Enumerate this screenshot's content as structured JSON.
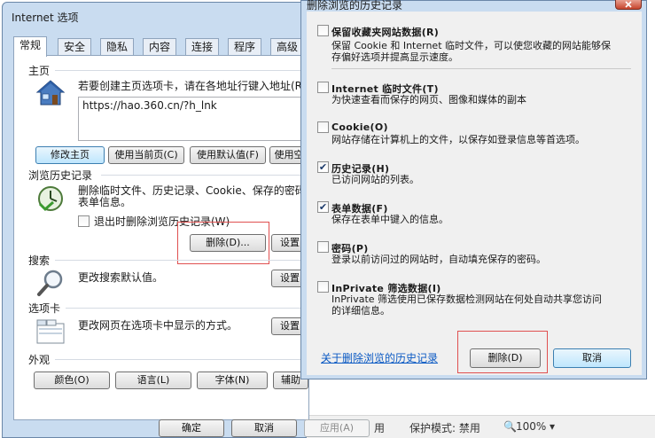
{
  "browser_bg": {
    "status_use": "用",
    "status_security": "保护模式: 禁用",
    "zoom": "100%"
  },
  "options": {
    "title": "Internet 选项",
    "tabs": [
      "常规",
      "安全",
      "隐私",
      "内容",
      "连接",
      "程序",
      "高级"
    ],
    "homepage": {
      "section": "主页",
      "instruction": "若要创建主页选项卡，请在各地址行键入地址(R",
      "url": "https://hao.360.cn/?h_lnk",
      "btn_current": "使用当前页(C)",
      "btn_default": "使用默认值(F)",
      "btn_blank": "使用空",
      "btn_edit": "修改主页"
    },
    "history": {
      "section": "浏览历史记录",
      "desc_line1": "删除临时文件、历史记录、Cookie、保存的密码",
      "desc_line2": "表单信息。",
      "exit_checkbox": "退出时删除浏览历史记录(W)",
      "btn_delete": "删除(D)...",
      "btn_settings": "设置"
    },
    "search": {
      "section": "搜索",
      "desc": "更改搜索默认值。",
      "btn_settings": "设置"
    },
    "tabs_section": {
      "section": "选项卡",
      "desc": "更改网页在选项卡中显示的方式。",
      "btn_settings": "设置"
    },
    "appearance": {
      "section": "外观",
      "btn_colors": "颜色(O)",
      "btn_languages": "语言(L)",
      "btn_fonts": "字体(N)",
      "btn_accessibility": "辅助"
    },
    "footer": {
      "ok": "确定",
      "cancel": "取消",
      "apply": "应用(A)"
    }
  },
  "delete_dialog": {
    "title": "删除浏览的历史记录",
    "items": [
      {
        "label": "保留收藏夹网站数据(R)",
        "desc1": "保留 Cookie 和 Internet 临时文件，可以使您收藏的网站能够保",
        "desc2": "存偏好选项并提高显示速度。",
        "checked": false
      },
      {
        "label": "Internet 临时文件(T)",
        "desc1": "为快速查看而保存的网页、图像和媒体的副本",
        "desc2": "",
        "checked": false
      },
      {
        "label": "Cookie(O)",
        "desc1": "网站存储在计算机上的文件，以保存如登录信息等首选项。",
        "desc2": "",
        "checked": false
      },
      {
        "label": "历史记录(H)",
        "desc1": "已访问网站的列表。",
        "desc2": "",
        "checked": true
      },
      {
        "label": "表单数据(F)",
        "desc1": "保存在表单中键入的信息。",
        "desc2": "",
        "checked": true
      },
      {
        "label": "密码(P)",
        "desc1": "登录以前访问过的网站时，自动填充保存的密码。",
        "desc2": "",
        "checked": false
      },
      {
        "label": "InPrivate 筛选数据(I)",
        "desc1": "InPrivate 筛选使用已保存数据检测网站在何处自动共享您访问",
        "desc2": "的详细信息。",
        "checked": false
      }
    ],
    "link": "关于删除浏览的历史记录",
    "btn_delete": "删除(D)",
    "btn_cancel": "取消",
    "check_mark": "✔"
  }
}
